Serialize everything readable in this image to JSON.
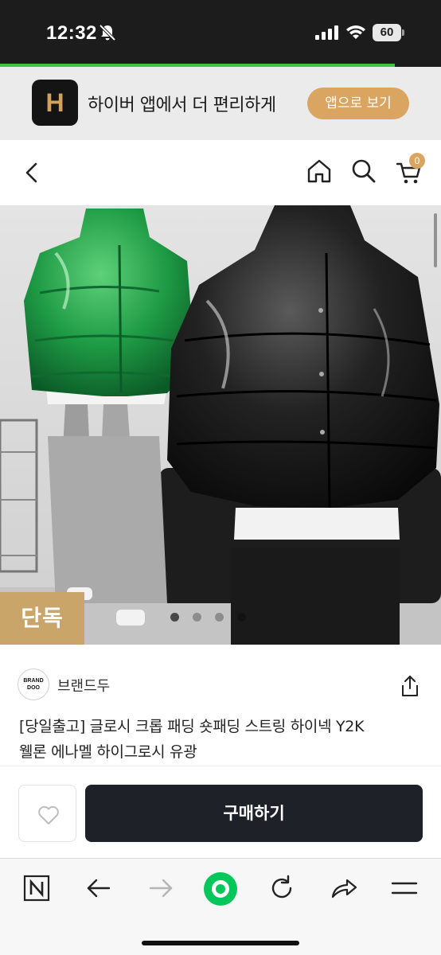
{
  "status_bar": {
    "time": "12:32",
    "battery": "60",
    "icons": [
      "bell-slash-icon",
      "signal-icon",
      "wifi-icon",
      "battery-icon"
    ]
  },
  "app_banner": {
    "logo_letter": "H",
    "text": "하이버 앱에서 더 편리하게",
    "button": "앱으로 보기",
    "accent_color": "#d9a561"
  },
  "top_nav": {
    "icons": [
      "back-chevron-icon",
      "home-icon",
      "search-icon",
      "cart-icon"
    ],
    "cart_count": "0"
  },
  "product": {
    "image_subject": "two people wearing glossy puffer jackets (green and black) with grey and black cargo pants",
    "badge": "단독",
    "carousel_total": 4,
    "carousel_active": 1,
    "brand": {
      "logo_text": "BRAND\nDOO",
      "name": "브랜드두"
    },
    "title_line1": "[당일출고] 글로시 크롭 패딩 숏패딩 스트링 하이넥 Y2K",
    "title_line2": "웰론 에나멜 하이그로시 유광"
  },
  "purchase": {
    "like_icon": "heart-icon",
    "buy_label": "구매하기",
    "buy_color": "#1f2129"
  },
  "browser_toolbar": {
    "icons": [
      "naver-n-icon",
      "back-arrow-icon",
      "forward-arrow-icon",
      "green-home-icon",
      "refresh-icon",
      "share-arrow-icon",
      "menu-icon"
    ],
    "accent_color": "#03c75a"
  }
}
